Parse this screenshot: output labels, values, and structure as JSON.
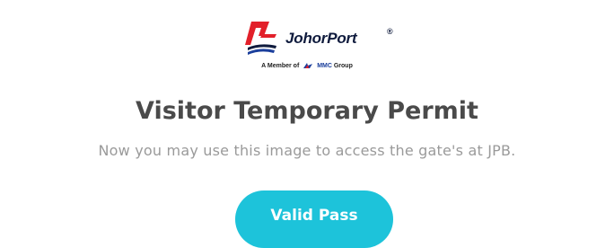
{
  "logo": {
    "brand_name": "JohorPort",
    "registered_mark": "®",
    "member_prefix": "A Member of",
    "member_group_brand": "MMC",
    "member_group_suffix": "Group",
    "icon": "johorport-logo-icon",
    "colors": {
      "red": "#e2202a",
      "navy": "#0f1b3d",
      "blue": "#1b3f9c"
    }
  },
  "page": {
    "title": "Visitor Temporary Permit",
    "subtitle": "Now you may use this image to access the gate's at JPB."
  },
  "actions": {
    "valid_pass_label": "Valid Pass",
    "valid_pass_color": "#1dc3da"
  }
}
